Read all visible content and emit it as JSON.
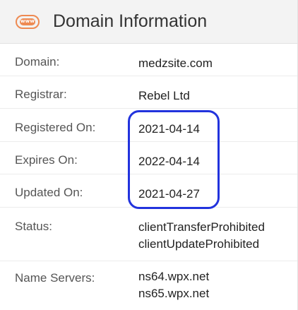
{
  "header": {
    "icon_text": "www",
    "title": "Domain Information"
  },
  "rows": [
    {
      "label": "Domain:",
      "value": "medzsite.com"
    },
    {
      "label": "Registrar:",
      "value": "Rebel Ltd"
    },
    {
      "label": "Registered On:",
      "value": "2021-04-14"
    },
    {
      "label": "Expires On:",
      "value": "2022-04-14"
    },
    {
      "label": "Updated On:",
      "value": "2021-04-27"
    },
    {
      "label": "Status:",
      "values": [
        "clientTransferProhibited",
        "clientUpdateProhibited"
      ]
    },
    {
      "label": "Name Servers:",
      "values": [
        "ns64.wpx.net",
        "ns65.wpx.net"
      ]
    }
  ],
  "highlight_color": "#2233dd",
  "icon_color": "#ee8a52"
}
